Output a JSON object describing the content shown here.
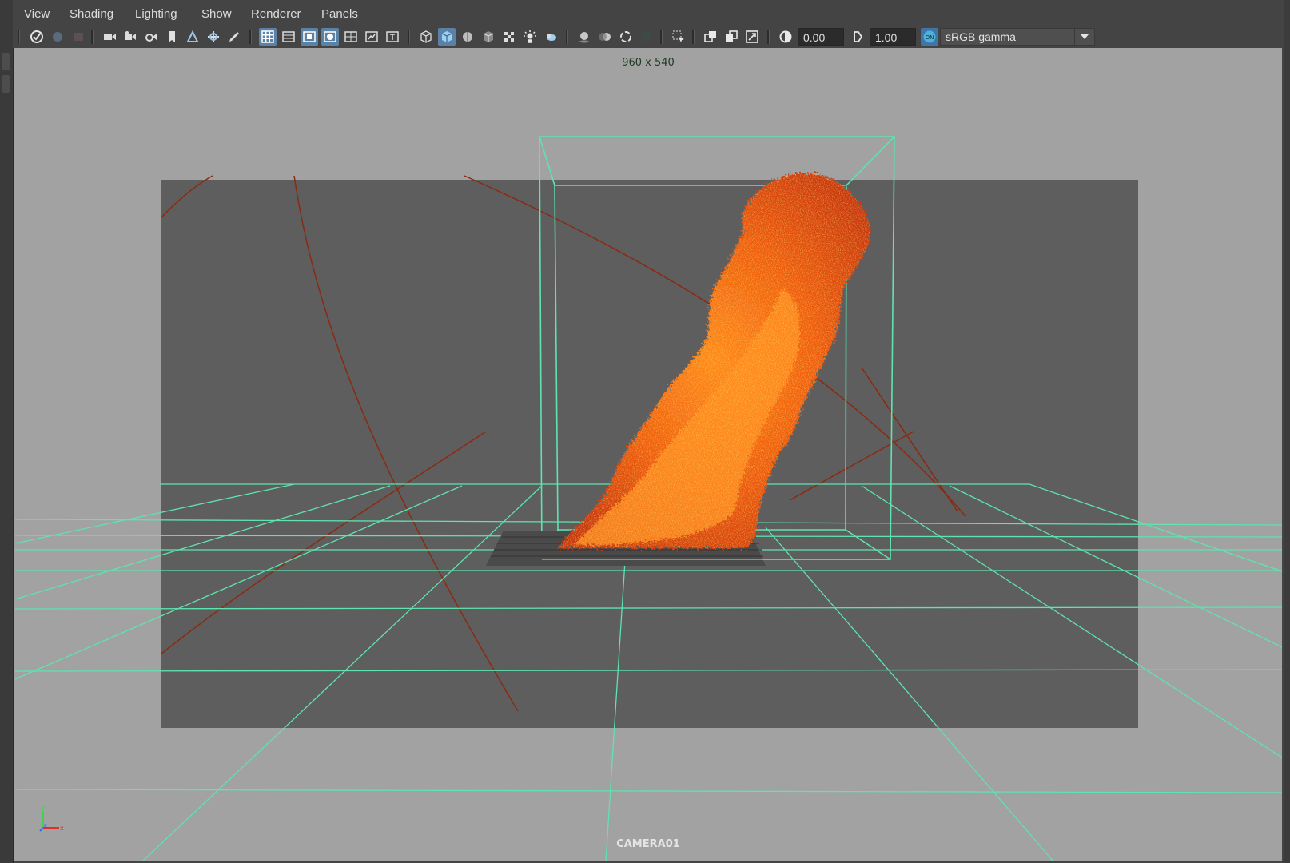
{
  "menubar": {
    "items": [
      "View",
      "Shading",
      "Lighting",
      "Show",
      "Renderer",
      "Panels"
    ]
  },
  "toolbar": {
    "icons": [
      "select-camera-icon",
      "lock-camera-icon",
      "camera-attributes-icon",
      "camera-icon",
      "bookmark-icon",
      "image-plane-icon",
      "2d-pan-zoom-icon",
      "grease-pencil-icon",
      "grid-icon",
      "film-gate-icon",
      "resolution-gate-icon",
      "gate-mask-icon",
      "field-chart-icon",
      "safe-action-icon",
      "safe-title-icon",
      "wireframe-icon",
      "smooth-shade-icon",
      "wireframe-on-shaded-icon",
      "xray-icon",
      "textured-icon",
      "use-all-lights-icon",
      "shadows-icon",
      "screen-space-ao-icon",
      "motion-blur-icon",
      "anti-aliasing-icon",
      "depth-of-field-icon",
      "isolate-select-icon",
      "xray-joints-icon",
      "xray-active-icon",
      "backface-culling-icon",
      "exposure-icon",
      "gamma-icon",
      "color-management-toggle-icon"
    ],
    "exposure_value": "0.00",
    "gamma_value": "1.00",
    "color_space": "sRGB gamma",
    "color_management_badge": "ON"
  },
  "viewport": {
    "resolution_label": "960 x 540",
    "camera_label": "CAMERA01",
    "axis_labels": {
      "x": "x",
      "y": "Y",
      "z": "z"
    }
  },
  "colors": {
    "viewport_bg": "#a2a2a2",
    "gate_bg": "#5e5e5e",
    "wire": "#5fe3b0",
    "curve": "#8a2a12",
    "fire_core": "#e85a0a",
    "fire_edge": "#ff8a1a",
    "active_button": "#5a82a6"
  }
}
